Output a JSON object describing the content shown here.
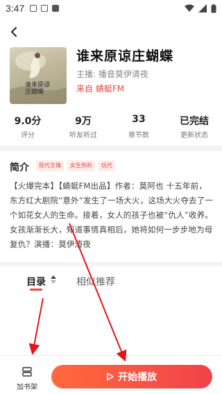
{
  "status_bar": {
    "time": "3:47"
  },
  "album": {
    "cover_text": "谁来原谅\n庄蝴蝶",
    "title": "谁来原谅庄蝴蝶",
    "host": "主播: 播音莫伊清夜",
    "source": "来自 蜻蜓FM"
  },
  "stats": [
    {
      "value": "9.0分",
      "label": "评分"
    },
    {
      "value": "9万",
      "label": "听友听过"
    },
    {
      "value": "33",
      "label": "章节数"
    },
    {
      "value": "已完结",
      "label": "更新状态"
    }
  ],
  "intro": {
    "heading": "简介",
    "tags": [
      "现代言情",
      "女生热听",
      "玩代"
    ],
    "text": "【火爆完本】【蜻蜓FM出品】作者：莫阿也 十五年前，东方红大剧院“意外”发生了一场大火，这场大火夺去了一个如花女人的生命。接着，女人的孩子也被“仇人”收养。女孩渐渐长大，知道事情真相后，她将如何一步步地为母复仇？演播：莫伊清夜"
  },
  "tabs": {
    "catalog": "目录",
    "similar": "相似推荐"
  },
  "bottom": {
    "shelf_label": "加书架",
    "play_label": "开始播放"
  },
  "colors": {
    "accent": "#e5483d",
    "play_gradient_start": "#ff6a3d",
    "play_gradient_end": "#f0434a"
  }
}
